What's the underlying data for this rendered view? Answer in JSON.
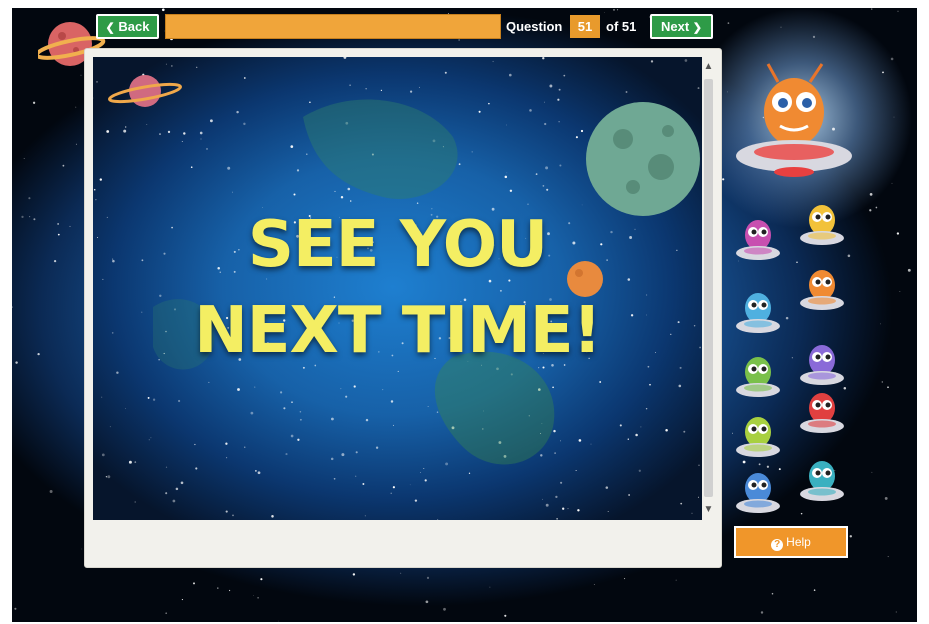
{
  "nav": {
    "back_label": "Back",
    "next_label": "Next",
    "back_icon": "chevron-left-icon",
    "next_icon": "chevron-right-icon"
  },
  "progress": {
    "question_label": "Question",
    "current": "51",
    "total_label": "of 51",
    "fraction": 1.0
  },
  "slide": {
    "line1": "SEE YOU",
    "line2": "NEXT TIME!"
  },
  "help": {
    "label": "Help",
    "icon_glyph": "?"
  },
  "colors": {
    "nav_green": "#2e9b47",
    "accent_orange": "#e89a2c",
    "slide_text": "#f4ee63"
  }
}
